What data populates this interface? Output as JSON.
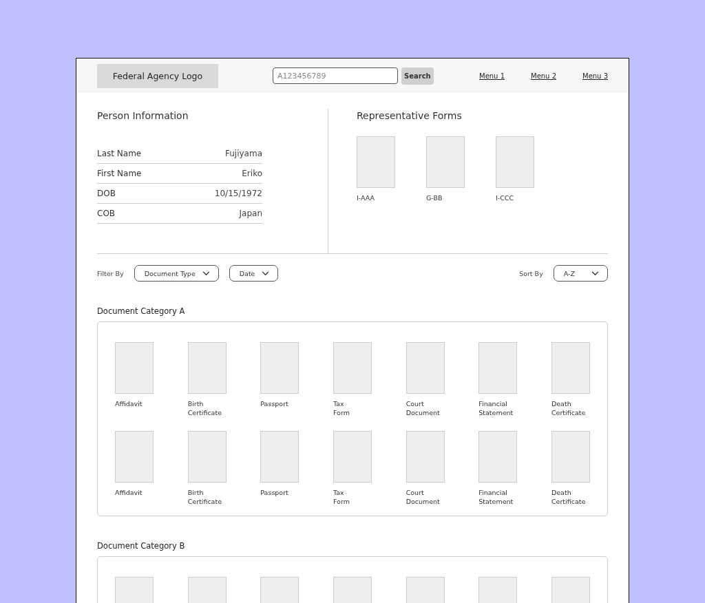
{
  "header": {
    "logo": "Federal Agency Logo",
    "search": {
      "placeholder": "A123456789",
      "button": "Search"
    },
    "menu": [
      "Menu 1",
      "Menu 2",
      "Menu 3"
    ]
  },
  "person": {
    "title": "Person Information",
    "fields": [
      {
        "label": "Last Name",
        "value": "Fujiyama"
      },
      {
        "label": "First Name",
        "value": "Eriko"
      },
      {
        "label": "DOB",
        "value": "10/15/1972"
      },
      {
        "label": "COB",
        "value": "Japan"
      }
    ]
  },
  "representative_forms": {
    "title": "Representative Forms",
    "forms": [
      "I-AAA",
      "G-BB",
      "I-CCC"
    ]
  },
  "filters": {
    "filter_label": "Filter By",
    "filter_dropdowns": [
      "Document Type",
      "Date"
    ],
    "sort_label": "Sort By",
    "sort_dropdown": "A-Z"
  },
  "categories": [
    {
      "title": "Document Category A",
      "documents": [
        {
          "kind": "labeled",
          "label": "Affidavit"
        },
        {
          "kind": "labeled",
          "label": "Birth Certificate"
        },
        {
          "kind": "labeled",
          "label": "Passport"
        },
        {
          "kind": "labeled",
          "label": "Tax Form"
        },
        {
          "kind": "labeled",
          "label": "Court Document"
        },
        {
          "kind": "labeled",
          "label": "Financial Statement"
        },
        {
          "kind": "labeled",
          "label": "Death Certificate"
        },
        {
          "kind": "labeled",
          "label": "Affidavit"
        },
        {
          "kind": "labeled",
          "label": "Birth Certificate"
        },
        {
          "kind": "labeled",
          "label": "Passport"
        },
        {
          "kind": "labeled",
          "label": "Tax Form"
        },
        {
          "kind": "labeled",
          "label": "Court Document"
        },
        {
          "kind": "labeled",
          "label": "Financial Statement"
        },
        {
          "kind": "labeled",
          "label": "Death Certificate"
        }
      ]
    },
    {
      "title": "Document Category B",
      "documents": [
        {
          "kind": "thumbnail"
        },
        {
          "kind": "thumbnail"
        },
        {
          "kind": "thumbnail"
        },
        {
          "kind": "thumbnail"
        },
        {
          "kind": "thumbnail"
        },
        {
          "kind": "thumbnail"
        },
        {
          "kind": "thumbnail"
        }
      ]
    }
  ]
}
